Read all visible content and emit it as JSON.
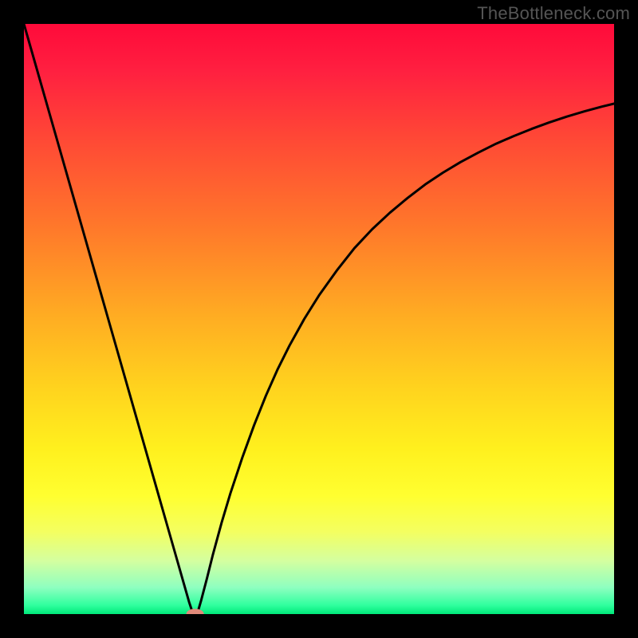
{
  "watermark": "TheBottleneck.com",
  "chart_data": {
    "type": "line",
    "title": "",
    "xlabel": "",
    "ylabel": "",
    "xlim": [
      0,
      1
    ],
    "ylim": [
      0,
      1
    ],
    "background_gradient": {
      "stops": [
        {
          "offset": 0.0,
          "color": "#ff0a3a"
        },
        {
          "offset": 0.08,
          "color": "#ff2040"
        },
        {
          "offset": 0.2,
          "color": "#ff4a35"
        },
        {
          "offset": 0.35,
          "color": "#ff7a2a"
        },
        {
          "offset": 0.5,
          "color": "#ffae22"
        },
        {
          "offset": 0.62,
          "color": "#ffd41e"
        },
        {
          "offset": 0.72,
          "color": "#fff01e"
        },
        {
          "offset": 0.8,
          "color": "#ffff30"
        },
        {
          "offset": 0.86,
          "color": "#f4ff60"
        },
        {
          "offset": 0.91,
          "color": "#d4ffa0"
        },
        {
          "offset": 0.955,
          "color": "#8effc0"
        },
        {
          "offset": 0.985,
          "color": "#30ff9e"
        },
        {
          "offset": 1.0,
          "color": "#00e87a"
        }
      ]
    },
    "series": [
      {
        "name": "curve",
        "stroke": "#000000",
        "stroke_width": 3,
        "points": [
          {
            "x": 0.0,
            "y": 1.0
          },
          {
            "x": 0.02,
            "y": 0.93
          },
          {
            "x": 0.04,
            "y": 0.86
          },
          {
            "x": 0.06,
            "y": 0.79
          },
          {
            "x": 0.08,
            "y": 0.72
          },
          {
            "x": 0.1,
            "y": 0.65
          },
          {
            "x": 0.12,
            "y": 0.58
          },
          {
            "x": 0.14,
            "y": 0.51
          },
          {
            "x": 0.16,
            "y": 0.44
          },
          {
            "x": 0.18,
            "y": 0.37
          },
          {
            "x": 0.2,
            "y": 0.3
          },
          {
            "x": 0.22,
            "y": 0.23
          },
          {
            "x": 0.24,
            "y": 0.16
          },
          {
            "x": 0.26,
            "y": 0.09
          },
          {
            "x": 0.27,
            "y": 0.055
          },
          {
            "x": 0.28,
            "y": 0.02
          },
          {
            "x": 0.285,
            "y": 0.005
          },
          {
            "x": 0.29,
            "y": 0.0
          },
          {
            "x": 0.295,
            "y": 0.005
          },
          {
            "x": 0.3,
            "y": 0.022
          },
          {
            "x": 0.31,
            "y": 0.06
          },
          {
            "x": 0.32,
            "y": 0.1
          },
          {
            "x": 0.335,
            "y": 0.155
          },
          {
            "x": 0.35,
            "y": 0.205
          },
          {
            "x": 0.37,
            "y": 0.265
          },
          {
            "x": 0.39,
            "y": 0.32
          },
          {
            "x": 0.41,
            "y": 0.37
          },
          {
            "x": 0.43,
            "y": 0.415
          },
          {
            "x": 0.45,
            "y": 0.455
          },
          {
            "x": 0.475,
            "y": 0.5
          },
          {
            "x": 0.5,
            "y": 0.54
          },
          {
            "x": 0.53,
            "y": 0.582
          },
          {
            "x": 0.56,
            "y": 0.62
          },
          {
            "x": 0.59,
            "y": 0.652
          },
          {
            "x": 0.62,
            "y": 0.68
          },
          {
            "x": 0.65,
            "y": 0.705
          },
          {
            "x": 0.68,
            "y": 0.728
          },
          {
            "x": 0.71,
            "y": 0.748
          },
          {
            "x": 0.74,
            "y": 0.766
          },
          {
            "x": 0.77,
            "y": 0.782
          },
          {
            "x": 0.8,
            "y": 0.797
          },
          {
            "x": 0.83,
            "y": 0.81
          },
          {
            "x": 0.86,
            "y": 0.822
          },
          {
            "x": 0.89,
            "y": 0.833
          },
          {
            "x": 0.92,
            "y": 0.843
          },
          {
            "x": 0.95,
            "y": 0.852
          },
          {
            "x": 0.98,
            "y": 0.86
          },
          {
            "x": 1.0,
            "y": 0.865
          }
        ]
      }
    ],
    "marker": {
      "x": 0.29,
      "y": 0.0,
      "rx": 0.015,
      "ry": 0.009,
      "fill": "#e08a7a"
    }
  }
}
